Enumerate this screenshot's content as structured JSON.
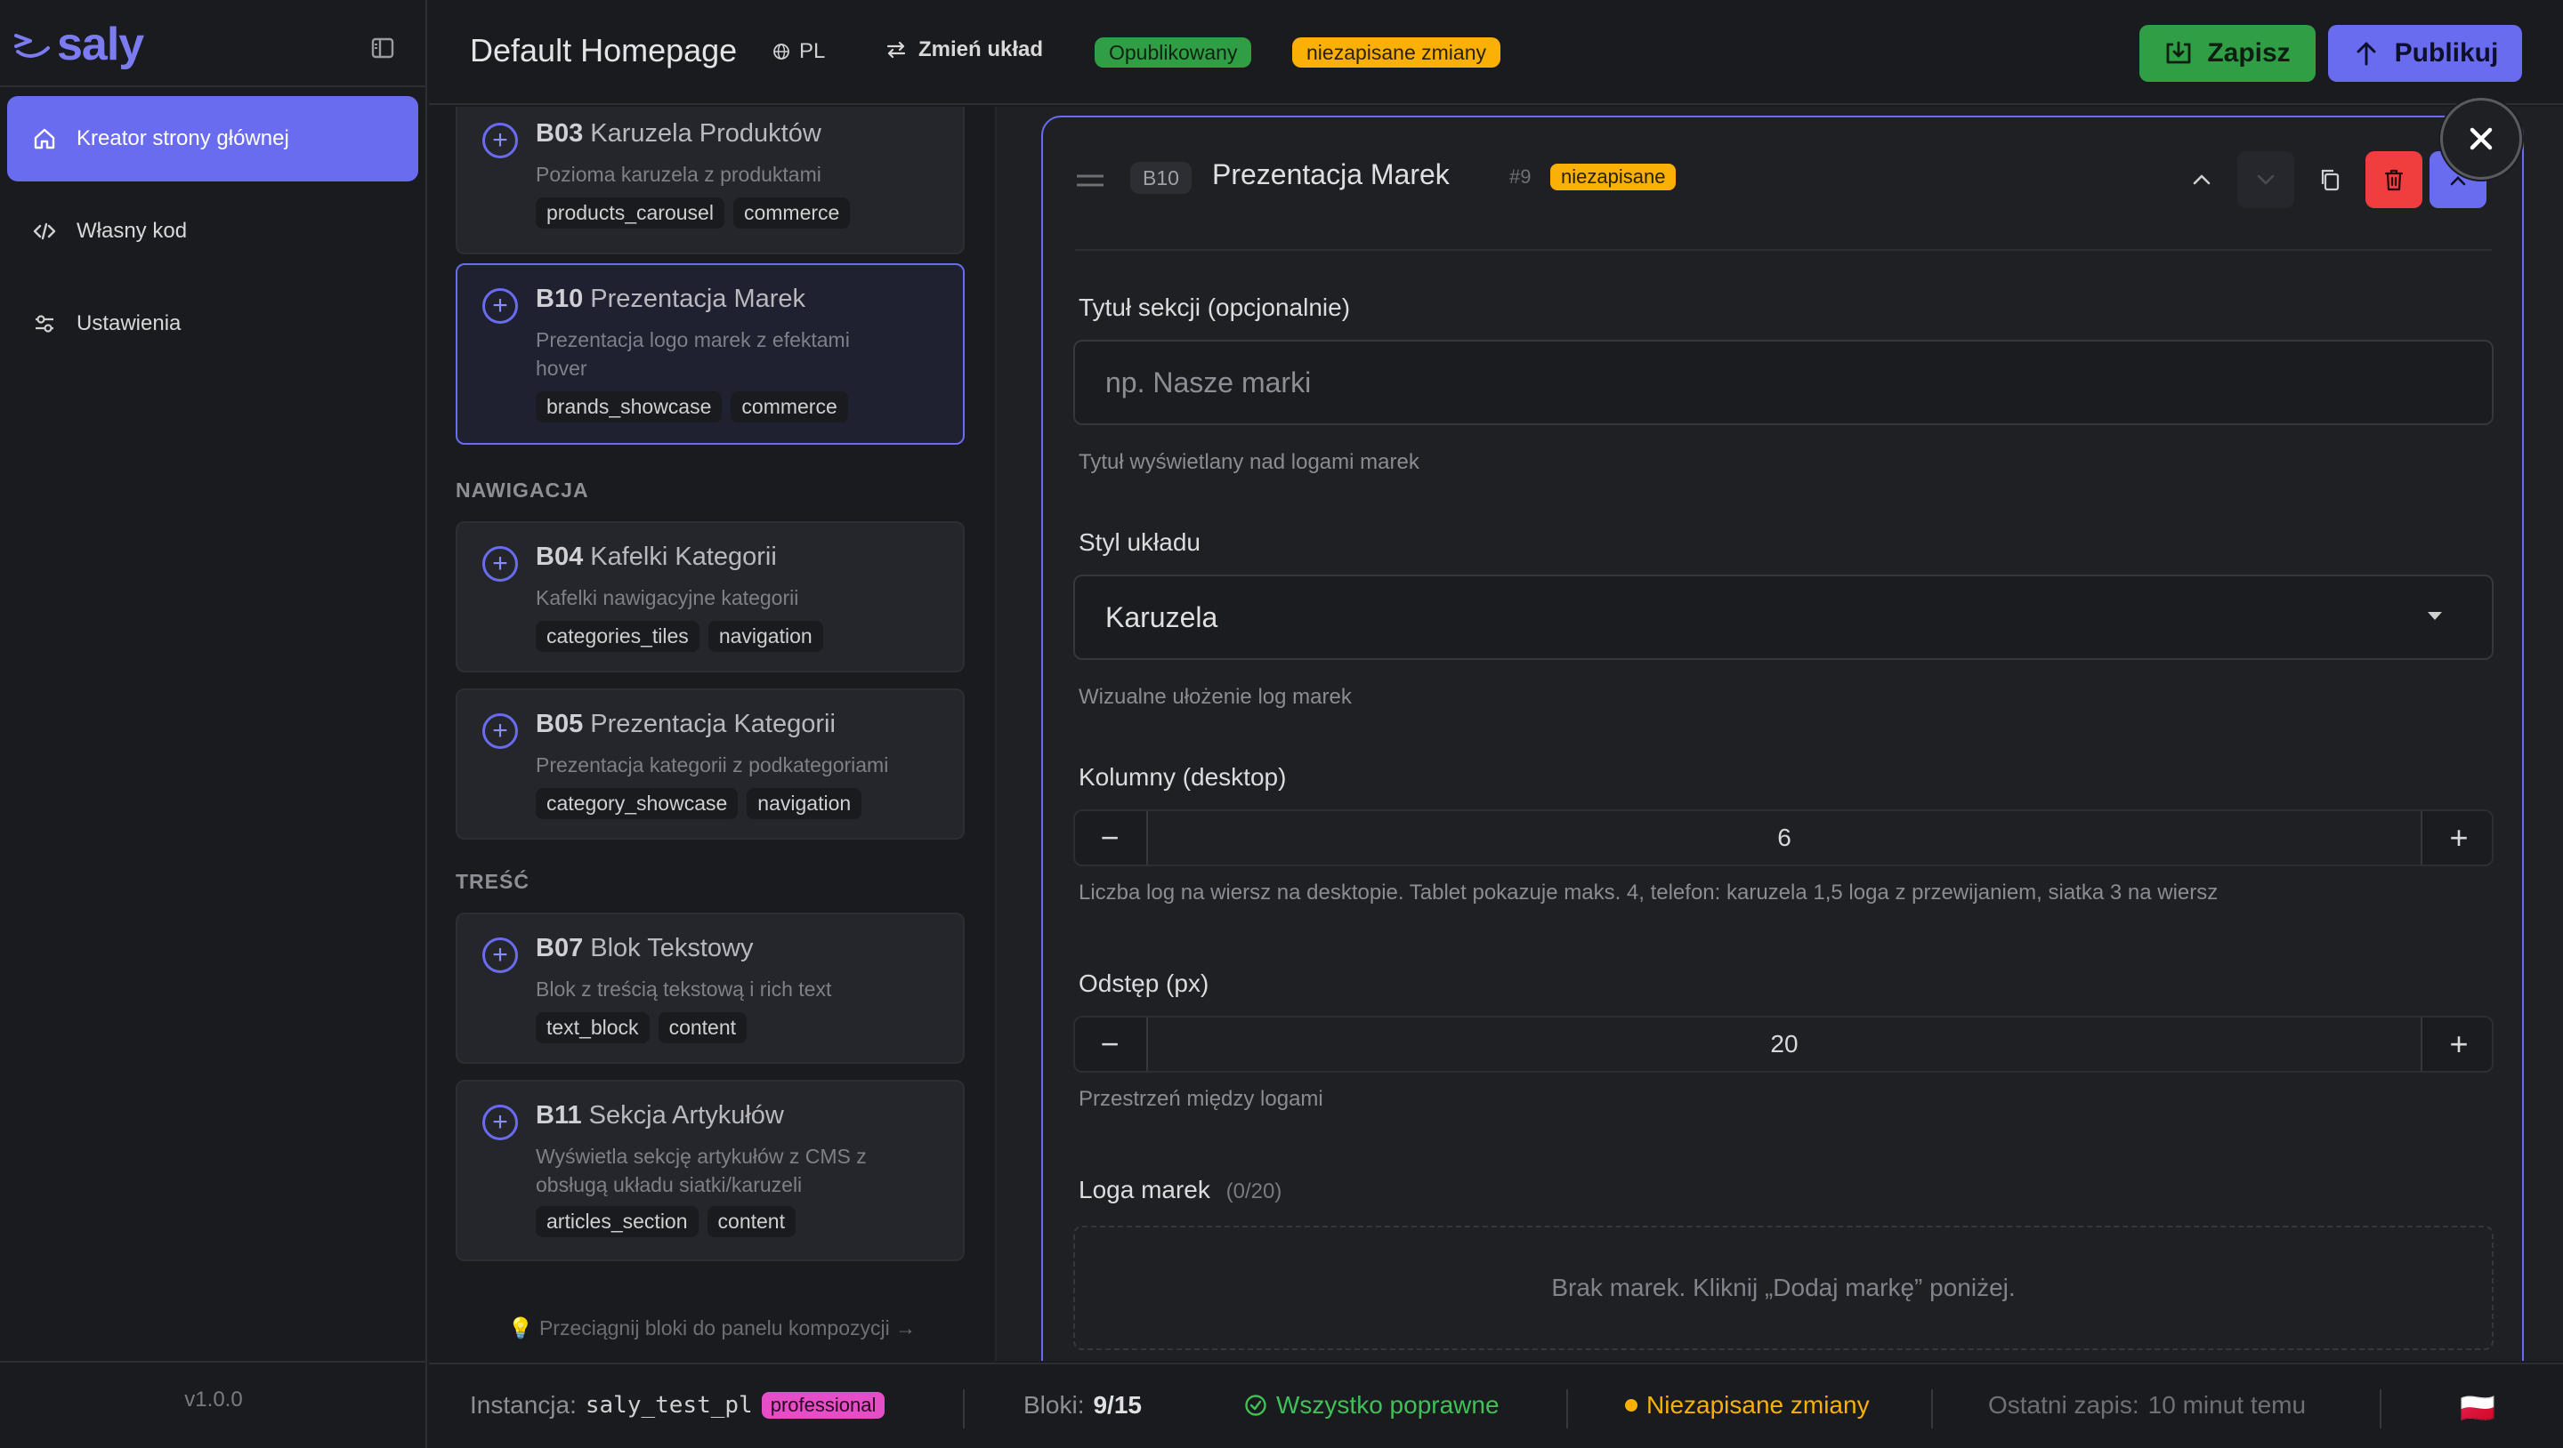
{
  "app": {
    "brand": "saly",
    "version": "v1.0.0"
  },
  "sidebar": {
    "items": [
      {
        "label": "Kreator strony głównej",
        "icon": "home-icon",
        "active": true
      },
      {
        "label": "Własny kod",
        "icon": "code-icon",
        "active": false
      },
      {
        "label": "Ustawienia",
        "icon": "sliders-icon",
        "active": false
      }
    ]
  },
  "header": {
    "title": "Default Homepage",
    "lang": "PL",
    "layout_button": "Zmień układ",
    "status_published": "Opublikowany",
    "status_unsaved": "niezapisane zmiany",
    "save_label": "Zapisz",
    "publish_label": "Publikuj"
  },
  "library": {
    "groups": [
      {
        "label": "NAWIGACJA"
      },
      {
        "label": "TREŚĆ"
      }
    ],
    "blocks": [
      {
        "code": "B03",
        "name": "Karuzela Produktów",
        "desc": "Pozioma karuzela z produktami",
        "tags": [
          "products_carousel",
          "commerce"
        ]
      },
      {
        "code": "B10",
        "name": "Prezentacja Marek",
        "desc": "Prezentacja logo marek z efektami hover",
        "tags": [
          "brands_showcase",
          "commerce"
        ]
      },
      {
        "code": "B04",
        "name": "Kafelki Kategorii",
        "desc": "Kafelki nawigacyjne kategorii",
        "tags": [
          "categories_tiles",
          "navigation"
        ]
      },
      {
        "code": "B05",
        "name": "Prezentacja Kategorii",
        "desc": "Prezentacja kategorii z podkategoriami",
        "tags": [
          "category_showcase",
          "navigation"
        ]
      },
      {
        "code": "B07",
        "name": "Blok Tekstowy",
        "desc": "Blok z treścią tekstową i rich text",
        "tags": [
          "text_block",
          "content"
        ]
      },
      {
        "code": "B11",
        "name": "Sekcja Artykułów",
        "desc": "Wyświetla sekcję artykułów z CMS z obsługą układu siatki/karuzeli",
        "tags": [
          "articles_section",
          "content"
        ]
      }
    ],
    "drag_hint": "Przeciągnij bloki do panelu kompozycji →"
  },
  "editor": {
    "code": "B10",
    "title": "Prezentacja Marek",
    "number": "#9",
    "badge": "niezapisane",
    "fields": {
      "title": {
        "label": "Tytuł sekcji (opcjonalnie)",
        "placeholder": "np. Nasze marki",
        "hint": "Tytuł wyświetlany nad logami marek"
      },
      "layout": {
        "label": "Styl układu",
        "value": "Karuzela",
        "hint": "Wizualne ułożenie log marek"
      },
      "columns": {
        "label": "Kolumny (desktop)",
        "value": "6",
        "hint": "Liczba log na wiersz na desktopie. Tablet pokazuje maks. 4, telefon: karuzela 1,5 loga z przewijaniem, siatka 3 na wiersz"
      },
      "gap": {
        "label": "Odstęp (px)",
        "value": "20",
        "hint": "Przestrzeń między logami"
      },
      "logos": {
        "label": "Loga marek",
        "count": "(0/20)",
        "empty": "Brak marek. Kliknij „Dodaj markę” poniżej."
      }
    },
    "colors": {
      "accent": "#6a6cf0",
      "danger": "#f03e3e",
      "success": "#2f9e44",
      "warning": "#fab005"
    }
  },
  "statusbar": {
    "instance_label": "Instancja:",
    "instance_value": "saly_test_pl",
    "plan": "professional",
    "blocks_label": "Bloki:",
    "blocks_value": "9/15",
    "valid": "Wszystko poprawne",
    "unsaved": "Niezapisane zmiany",
    "last_save_label": "Ostatni zapis:",
    "last_save_value": "10 minut temu",
    "flag": "🇵🇱"
  }
}
